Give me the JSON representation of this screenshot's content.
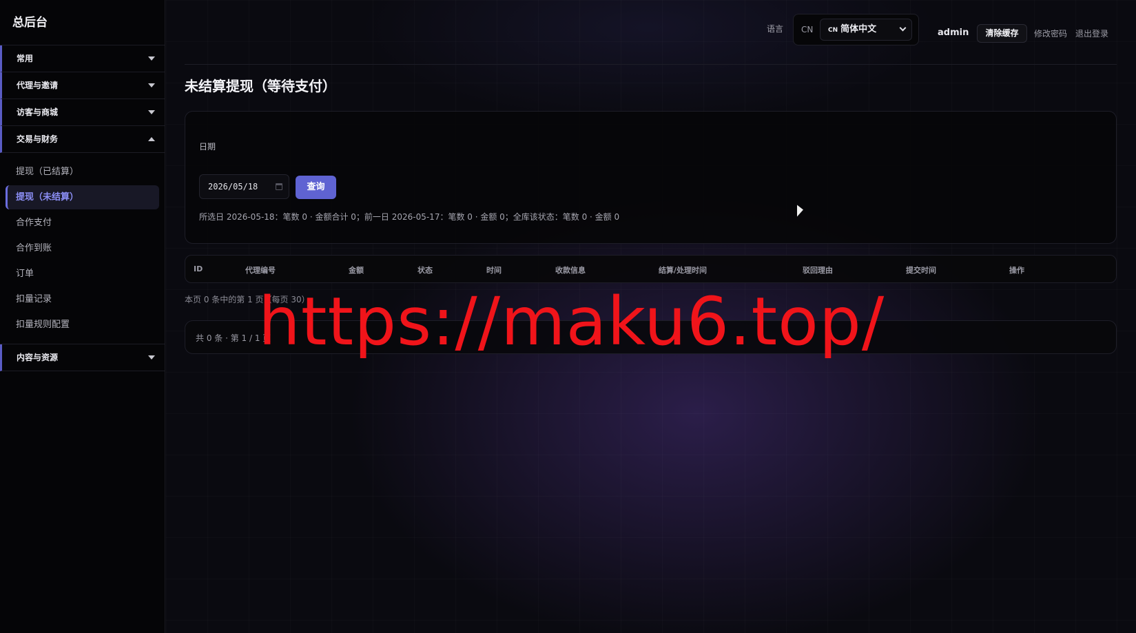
{
  "sidebar": {
    "brand": "总后台",
    "groups": [
      {
        "label": "常用"
      },
      {
        "label": "代理与邀请"
      },
      {
        "label": "访客与商城"
      },
      {
        "label": "交易与财务"
      },
      {
        "label": "内容与资源"
      }
    ],
    "finance_items": [
      {
        "label": "提现（已结算）"
      },
      {
        "label": "提现（未结算）"
      },
      {
        "label": "合作支付"
      },
      {
        "label": "合作到账"
      },
      {
        "label": "订单"
      },
      {
        "label": "扣量记录"
      },
      {
        "label": "扣量规则配置"
      }
    ]
  },
  "topbar": {
    "lang_label": "语言",
    "lang_code": "CN",
    "lang_select_code": "CN",
    "lang_select_value": "简体中文",
    "user": "admin",
    "clear_cache": "清除缓存",
    "change_password": "修改密码",
    "logout": "退出登录"
  },
  "page": {
    "title": "未结算提现（等待支付）"
  },
  "filter": {
    "date_label": "日期",
    "date_value": "2026/05/18",
    "query_button": "查询",
    "summary": "所选日 2026-05-18：笔数 0 · 金额合计 0；前一日 2026-05-17：笔数 0 · 金额 0；全库该状态：笔数 0 · 金额 0"
  },
  "table": {
    "columns": [
      "ID",
      "代理编号",
      "金额",
      "状态",
      "时间",
      "收款信息",
      "结算/处理时间",
      "驳回理由",
      "提交时间",
      "操作"
    ]
  },
  "pagination": {
    "page_info": "本页 0 条中的第 1 页（每页 30）",
    "total_text": "共 0 条 · 第 1 / 1 页"
  },
  "watermark": "https://maku6.top/",
  "colors": {
    "accent": "#5f63d2",
    "active_nav_text": "#8c8ff6",
    "watermark": "#f0141a"
  }
}
